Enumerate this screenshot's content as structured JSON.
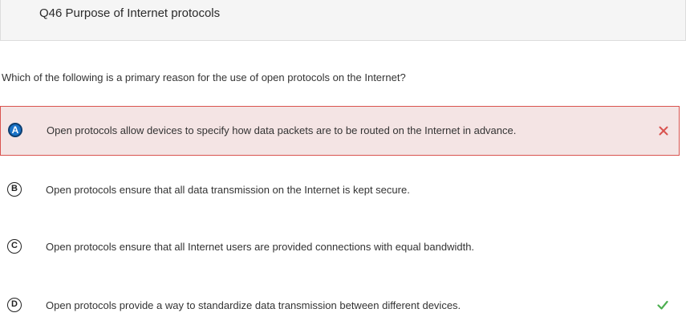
{
  "question": {
    "title": "Q46 Purpose of Internet protocols",
    "prompt": "Which of the following is a primary reason for the use of open protocols on the Internet?"
  },
  "choices": [
    {
      "letter": "A",
      "text": "Open protocols allow devices to specify how data packets are to be routed on the Internet in advance.",
      "state": "selected-incorrect",
      "mark": "cross-icon"
    },
    {
      "letter": "B",
      "text": "Open protocols ensure that all data transmission on the Internet is kept secure.",
      "state": "unselected"
    },
    {
      "letter": "C",
      "text": "Open protocols ensure that all Internet users are provided connections with equal bandwidth.",
      "state": "unselected"
    },
    {
      "letter": "D",
      "text": "Open protocols provide a way to standardize data transmission between different devices.",
      "state": "correct",
      "mark": "checkmark-icon"
    }
  ],
  "colors": {
    "incorrect": "#d9534f",
    "incorrect_bg": "#f4e4e4",
    "correct": "#4caf50",
    "selected_letter": "#1a73c8"
  }
}
